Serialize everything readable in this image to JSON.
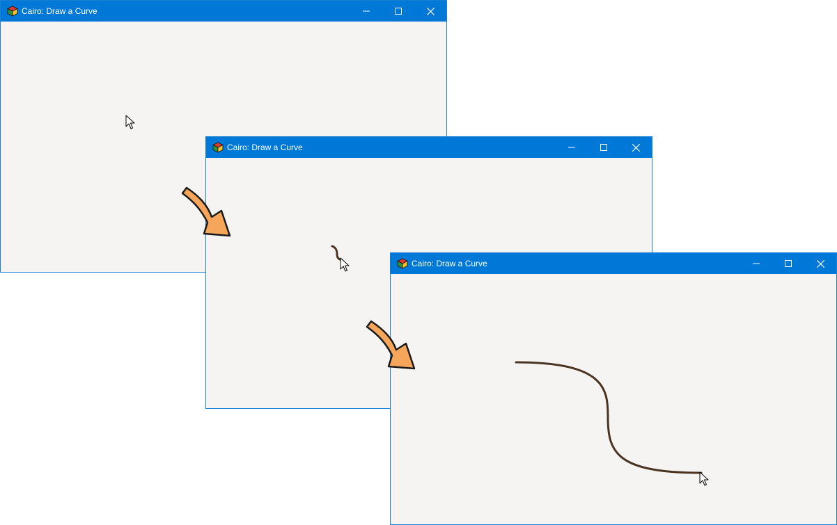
{
  "windows": [
    {
      "title": "Cairo: Draw a Curve",
      "icon": "cairo-cube-icon",
      "controls": [
        "minimize-icon",
        "maximize-icon",
        "close-icon"
      ]
    },
    {
      "title": "Cairo: Draw a Curve",
      "icon": "cairo-cube-icon",
      "controls": [
        "minimize-icon",
        "maximize-icon",
        "close-icon"
      ]
    },
    {
      "title": "Cairo: Draw a Curve",
      "icon": "cairo-cube-icon",
      "controls": [
        "minimize-icon",
        "maximize-icon",
        "close-icon"
      ]
    }
  ],
  "colors": {
    "titlebar": "#0078d7",
    "window_border": "#1e7ed2",
    "canvas_background": "#f5f4f2",
    "curve_stroke": "#4a3320",
    "arrow_fill": "#f5a65b",
    "arrow_outline": "#1a1a1a"
  },
  "decorations": {
    "step_arrows": [
      "arrow-step-1-to-2",
      "arrow-step-2-to-3"
    ],
    "cursor_icon": "mouse-pointer-icon"
  }
}
